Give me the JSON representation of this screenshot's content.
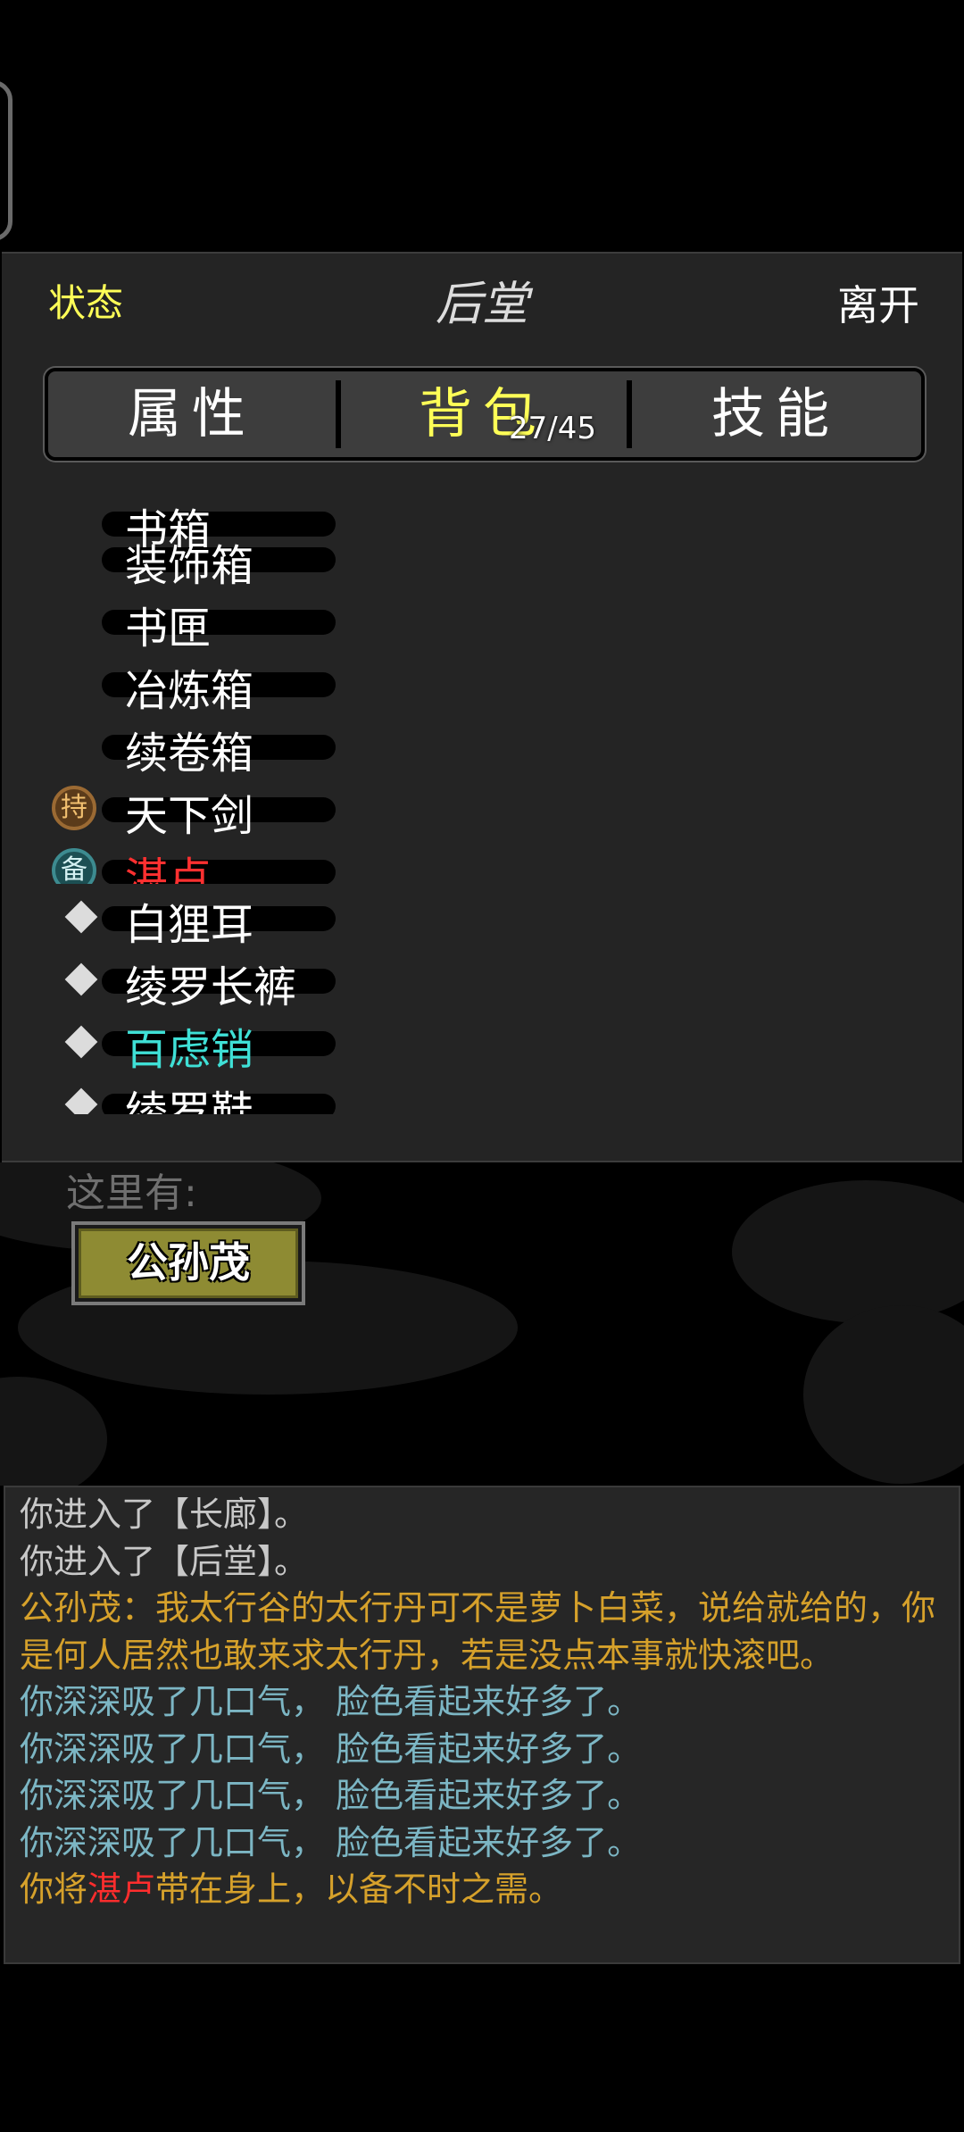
{
  "header": {
    "status_label": "状态",
    "title": "后堂",
    "leave_label": "离开"
  },
  "tabs": [
    {
      "label": "属性"
    },
    {
      "label": "背包"
    },
    {
      "label": "技能"
    }
  ],
  "bag": {
    "count": "27/45"
  },
  "inventory": [
    {
      "label": "书箱",
      "marker": "none",
      "color": "white"
    },
    {
      "label": "装饰箱",
      "marker": "none",
      "color": "white"
    },
    {
      "label": "书匣",
      "marker": "none",
      "color": "white"
    },
    {
      "label": "冶炼箱",
      "marker": "none",
      "color": "white"
    },
    {
      "label": "续卷箱",
      "marker": "none",
      "color": "white"
    },
    {
      "label": "天下剑",
      "marker": "持",
      "color": "white"
    },
    {
      "label": "湛卢",
      "marker": "备",
      "color": "red"
    },
    {
      "label": "白狸耳",
      "marker": "diamond",
      "color": "white"
    },
    {
      "label": "绫罗长裤",
      "marker": "diamond",
      "color": "white"
    },
    {
      "label": "百虑销",
      "marker": "diamond",
      "color": "cyan"
    },
    {
      "label": "绫罗鞋",
      "marker": "diamond",
      "color": "white"
    }
  ],
  "here": {
    "label": "这里有:",
    "npc": "公孙茂"
  },
  "log": {
    "line1": "你进入了【长廊】。",
    "line2": "你进入了【后堂】。",
    "line3": "公孙茂：我太行谷的太行丹可不是萝卜白菜，说给就给的，你是何人居然也敢来求太行丹，若是没点本事就快滚吧。",
    "line4": "你深深吸了几口气，  脸色看起来好多了。",
    "line5": "你深深吸了几口气，  脸色看起来好多了。",
    "line6": "你深深吸了几口气，  脸色看起来好多了。",
    "line7": "你深深吸了几口气，  脸色看起来好多了。",
    "line8_pre": "你将",
    "line8_item": "湛卢",
    "line8_post": "带在身上，以备不时之需。"
  }
}
